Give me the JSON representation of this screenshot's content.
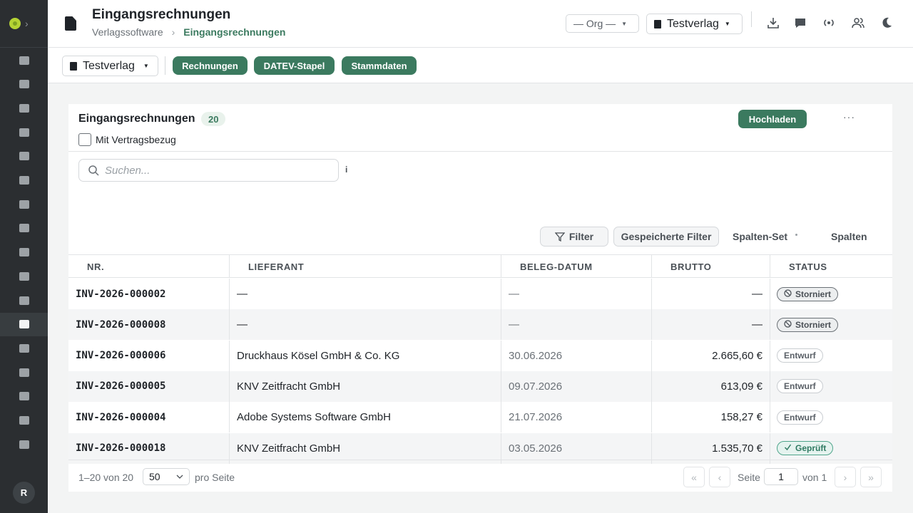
{
  "header": {
    "title": "Eingangsrechnungen",
    "breadcrumb": [
      "Verlagssoftware",
      "Eingangsrechnungen"
    ],
    "org_select": "— Org —",
    "publisher_select": "Testverlag",
    "icons": [
      "download-icon",
      "chat-icon",
      "broadcast-icon",
      "users-icon",
      "moon-icon"
    ]
  },
  "sidebar": {
    "icons": [
      "image-icon",
      "briefcase-icon",
      "contact-card-icon",
      "scroll-icon",
      "feather-icon",
      "card-icon",
      "circle-icon",
      "box-icon",
      "megaphone-icon",
      "video-icon",
      "music-icon",
      "document-icon",
      "truck-icon",
      "export-icon",
      "chart-icon",
      "ledger-icon",
      "shield-icon"
    ],
    "active": "document-icon",
    "avatar_initial": "R"
  },
  "toolbar": {
    "publisher": "Testverlag",
    "tabs": [
      "Rechnungen",
      "DATEV-Stapel",
      "Stammdaten"
    ]
  },
  "card": {
    "title": "Eingangsrechnungen",
    "count": "20",
    "upload_label": "Hochladen",
    "more_label": "···",
    "checkbox_label": "Mit Vertragsbezug",
    "search_placeholder": "Suchen...",
    "info_label": "i",
    "filter_label": "Filter",
    "saved_filter_label": "Gespeicherte Filter",
    "column_set_label": "Spalten-Set",
    "columns_label": "Spalten"
  },
  "table": {
    "columns": [
      "NR.",
      "LIEFERANT",
      "BELEG-DATUM",
      "BRUTTO",
      "STATUS"
    ],
    "rows": [
      {
        "nr": "INV-2026-000002",
        "lieferant": "—",
        "datum": "—",
        "brutto": "—",
        "status": "Storniert",
        "kind": "storniert"
      },
      {
        "nr": "INV-2026-000008",
        "lieferant": "—",
        "datum": "—",
        "brutto": "—",
        "status": "Storniert",
        "kind": "storniert"
      },
      {
        "nr": "INV-2026-000006",
        "lieferant": "Druckhaus Kösel GmbH & Co. KG",
        "datum": "30.06.2026",
        "brutto": "2.665,60 €",
        "status": "Entwurf",
        "kind": "entwurf"
      },
      {
        "nr": "INV-2026-000005",
        "lieferant": "KNV Zeitfracht GmbH",
        "datum": "09.07.2026",
        "brutto": "613,09 €",
        "status": "Entwurf",
        "kind": "entwurf"
      },
      {
        "nr": "INV-2026-000004",
        "lieferant": "Adobe Systems Software GmbH",
        "datum": "21.07.2026",
        "brutto": "158,27 €",
        "status": "Entwurf",
        "kind": "entwurf"
      },
      {
        "nr": "INV-2026-000018",
        "lieferant": "KNV Zeitfracht GmbH",
        "datum": "03.05.2026",
        "brutto": "1.535,70 €",
        "status": "Geprüft",
        "kind": "geprueft"
      }
    ]
  },
  "footer": {
    "range": "1–20 von 20",
    "per_page": "50",
    "per_page_label": "pro Seite",
    "page_label": "Seite",
    "page": "1",
    "of_label": "von 1",
    "nav": [
      "«",
      "‹",
      "›",
      "»"
    ]
  },
  "colors": {
    "accent": "#3b7a5f",
    "sidebar": "#2b2e31",
    "badge_checked": "#4fa58b"
  }
}
